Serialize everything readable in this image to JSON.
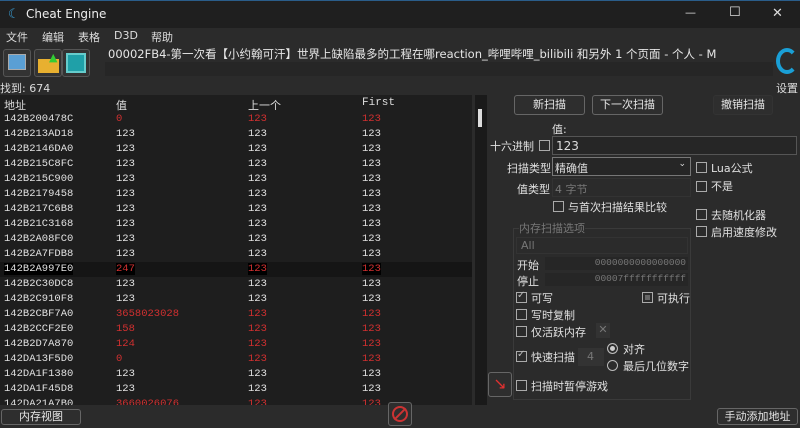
{
  "window": {
    "title": "Cheat Engine",
    "minimize": "—",
    "maximize": "☐",
    "close": "✕"
  },
  "menu": [
    "文件",
    "编辑",
    "表格",
    "D3D",
    "帮助"
  ],
  "process_title": "00002FB4-第一次看【小约翰可汗】世界上缺陷最多的工程在哪reaction_哔哩哔哩_bilibili 和另外 1 个页面 - 个人 - M",
  "settings_label": "设置",
  "found": "找到: 674",
  "columns": [
    "地址",
    "值",
    "上一个",
    "First"
  ],
  "rows": [
    {
      "address": "142B200478C",
      "value": "0",
      "previous": "123",
      "first": "123",
      "changed": true
    },
    {
      "address": "142B213AD18",
      "value": "123",
      "previous": "123",
      "first": "123",
      "changed": false
    },
    {
      "address": "142B2146DA0",
      "value": "123",
      "previous": "123",
      "first": "123",
      "changed": false
    },
    {
      "address": "142B215C8FC",
      "value": "123",
      "previous": "123",
      "first": "123",
      "changed": false
    },
    {
      "address": "142B215C900",
      "value": "123",
      "previous": "123",
      "first": "123",
      "changed": false
    },
    {
      "address": "142B2179458",
      "value": "123",
      "previous": "123",
      "first": "123",
      "changed": false
    },
    {
      "address": "142B217C6B8",
      "value": "123",
      "previous": "123",
      "first": "123",
      "changed": false
    },
    {
      "address": "142B21C3168",
      "value": "123",
      "previous": "123",
      "first": "123",
      "changed": false
    },
    {
      "address": "142B2A08FC0",
      "value": "123",
      "previous": "123",
      "first": "123",
      "changed": false
    },
    {
      "address": "142B2A7FDB8",
      "value": "123",
      "previous": "123",
      "first": "123",
      "changed": false
    },
    {
      "address": "142B2A997E0",
      "value": "247",
      "previous": "123",
      "first": "123",
      "changed": true,
      "selected": true
    },
    {
      "address": "142B2C30DC8",
      "value": "123",
      "previous": "123",
      "first": "123",
      "changed": false
    },
    {
      "address": "142B2C910F8",
      "value": "123",
      "previous": "123",
      "first": "123",
      "changed": false
    },
    {
      "address": "142B2CBF7A0",
      "value": "3658023028",
      "previous": "123",
      "first": "123",
      "changed": true
    },
    {
      "address": "142B2CCF2E0",
      "value": "158",
      "previous": "123",
      "first": "123",
      "changed": true
    },
    {
      "address": "142B2D7A870",
      "value": "124",
      "previous": "123",
      "first": "123",
      "changed": true
    },
    {
      "address": "142DA13F5D0",
      "value": "0",
      "previous": "123",
      "first": "123",
      "changed": true
    },
    {
      "address": "142DA1F1380",
      "value": "123",
      "previous": "123",
      "first": "123",
      "changed": false
    },
    {
      "address": "142DA1F45D8",
      "value": "123",
      "previous": "123",
      "first": "123",
      "changed": false
    },
    {
      "address": "142DA21A7B0",
      "value": "3660026076",
      "previous": "123",
      "first": "123",
      "changed": true
    }
  ],
  "scan": {
    "new_scan": "新扫描",
    "next_scan": "下一次扫描",
    "undo_scan": "撤销扫描",
    "value_label": "值:",
    "hex_label": "十六进制",
    "value": "123",
    "scan_type_label": "扫描类型",
    "scan_type": "精确值",
    "value_type_label": "值类型",
    "value_type": "4 字节",
    "compare_first": "与首次扫描结果比较",
    "lua_formula": "Lua公式",
    "not": "不是",
    "unrandomizer": "去随机化器",
    "speedhack": "启用速度修改",
    "mem_options_label": "内存扫描选项",
    "region": "All",
    "start_label": "开始",
    "start": "0000000000000000",
    "stop_label": "停止",
    "stop": "00007fffffffffff",
    "writable": "可写",
    "executable": "可执行",
    "copy_on_write": "写时复制",
    "active_memory": "仅活跃内存",
    "fast_scan": "快速扫描",
    "fast_scan_value": "4",
    "align": "对齐",
    "last_digits": "最后几位数字",
    "pause_game": "扫描时暂停游戏"
  },
  "bottom": {
    "memory_view": "内存视图",
    "add_address": "手动添加地址"
  },
  "colors": {
    "changed": "#d03030",
    "accent": "#1a9fd6"
  }
}
